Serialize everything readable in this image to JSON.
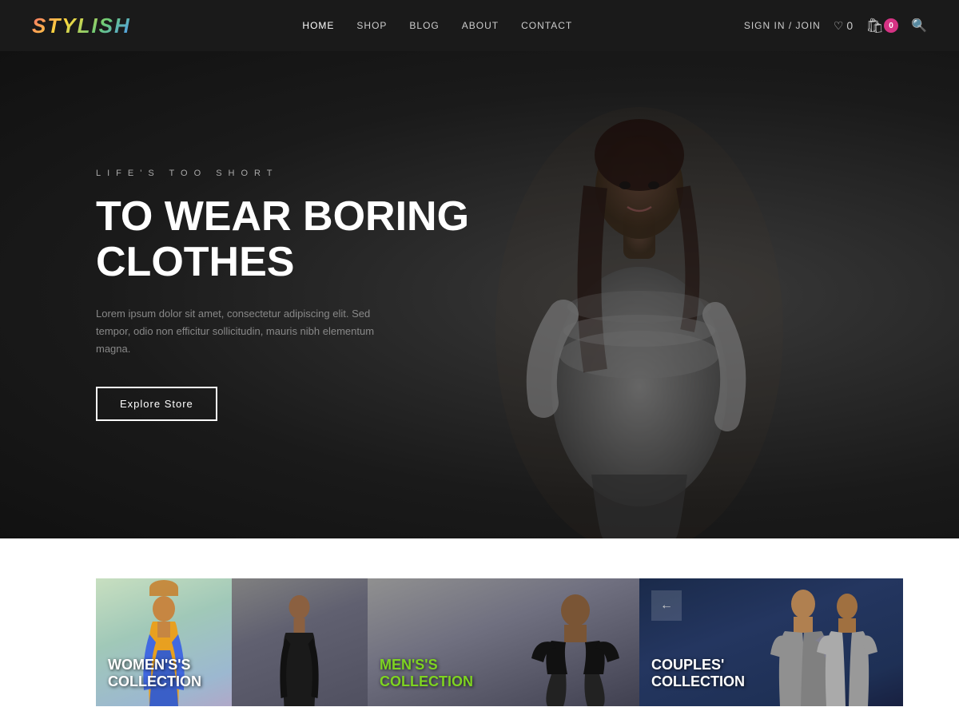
{
  "brand": {
    "name": "STYLISH"
  },
  "nav": {
    "links": [
      {
        "label": "HOME",
        "active": true
      },
      {
        "label": "SHOP",
        "active": false
      },
      {
        "label": "BLOG",
        "active": false
      },
      {
        "label": "ABOUT",
        "active": false
      },
      {
        "label": "CONTACT",
        "active": false
      }
    ],
    "signin_label": "SIGN IN / JOIN",
    "wishlist_count": "0",
    "cart_count": "0"
  },
  "hero": {
    "tagline": "LIFE'S TOO SHORT",
    "title_line1": "TO WEAR BORING",
    "title_line2": "CLOTHES",
    "description": "Lorem ipsum dolor sit amet, consectetur adipiscing elit. Sed tempor, odio non efficitur sollicitudin, mauris nibh elementum magna.",
    "cta_label": "Explore Store"
  },
  "collections": [
    {
      "label": "Women's",
      "sub": "Collection",
      "label_color": "white",
      "type": "women"
    },
    {
      "label": "Men's",
      "sub": "Collection",
      "label_color": "green",
      "type": "men"
    },
    {
      "label": "Couples'",
      "sub": "Collection",
      "label_color": "white",
      "type": "couples"
    }
  ],
  "icons": {
    "heart": "♡",
    "cart": "🛒",
    "search": "🔍",
    "arrow_left": "←"
  }
}
